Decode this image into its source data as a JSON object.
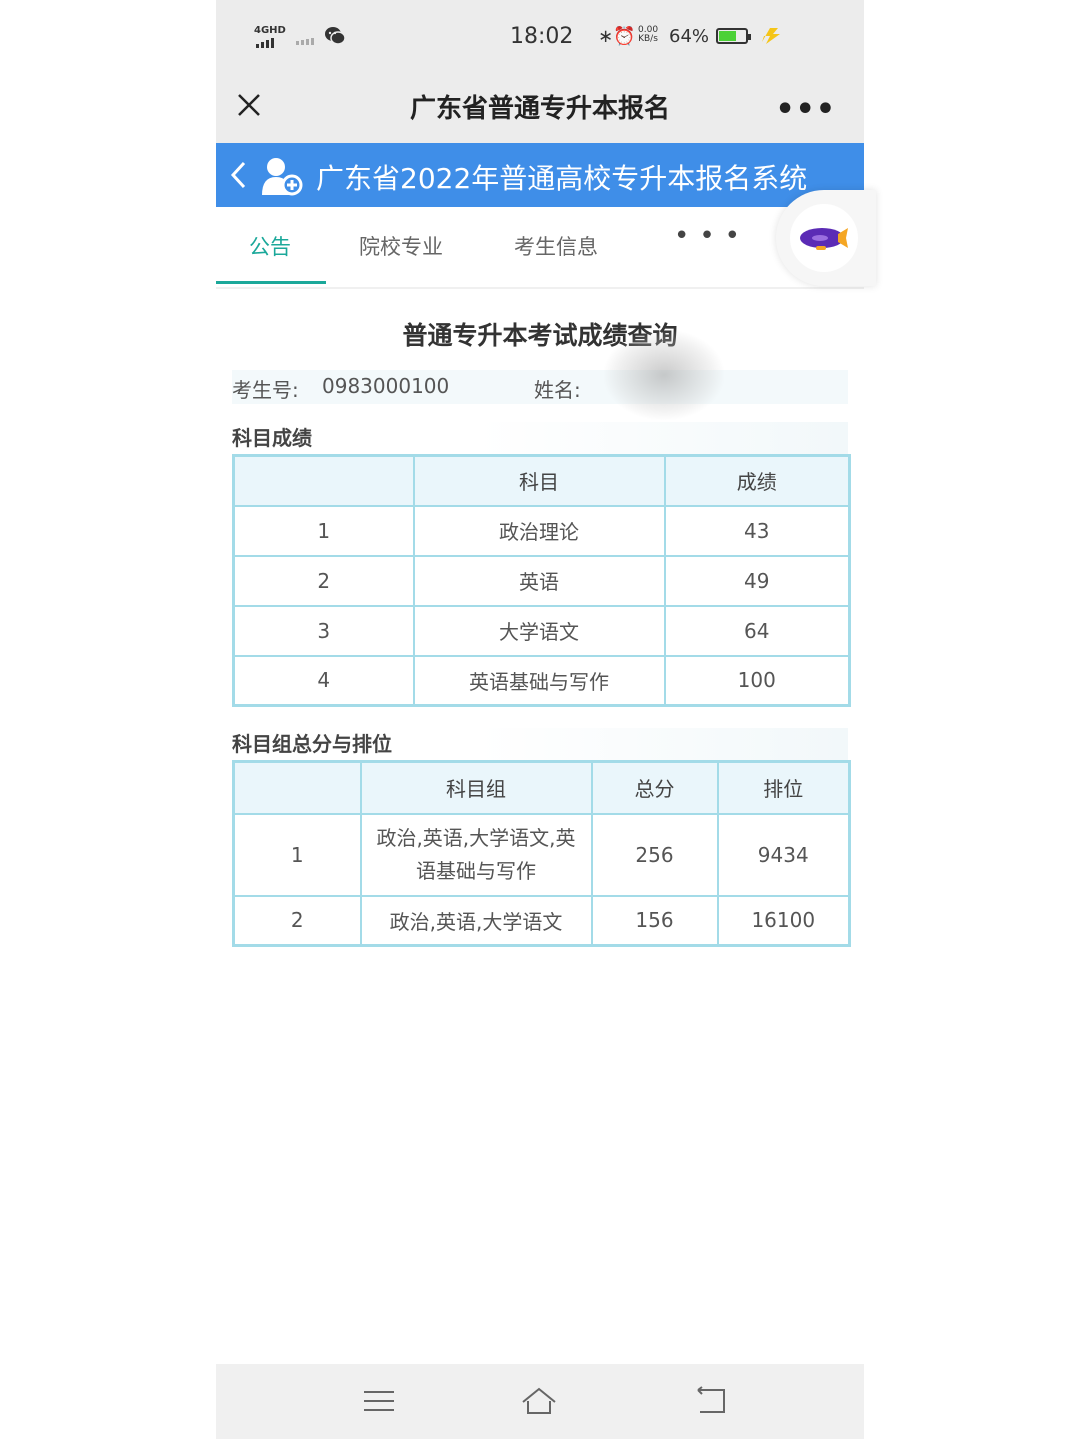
{
  "status_bar": {
    "network": "4GHD",
    "time": "18:02",
    "speed_value": "0.00",
    "speed_unit": "KB/s",
    "battery_percent": "64%",
    "battery_level": 0.64,
    "icons": [
      "signal-icon",
      "wechat-icon",
      "bluetooth-icon",
      "alarm-icon",
      "battery-icon",
      "charging-icon"
    ]
  },
  "wechat_header": {
    "title": "广东省普通专升本报名",
    "more": "•••"
  },
  "app_bar": {
    "title": "广东省2022年普通高校专升本报名系统",
    "color": "#3f8ee8"
  },
  "tabs": [
    {
      "label": "公告",
      "active": true
    },
    {
      "label": "院校专业",
      "active": false
    },
    {
      "label": "考生信息",
      "active": false
    }
  ],
  "tabs_more": "•••",
  "accent_color": "#1ba89a",
  "page": {
    "title": "普通专升本考试成绩查询",
    "candidate_no_label": "考生号:",
    "candidate_no": "0983000100",
    "name_label": "姓名:"
  },
  "scores": {
    "section_label": "科目成绩",
    "headers": [
      "",
      "科目",
      "成绩"
    ],
    "rows": [
      [
        "1",
        "政治理论",
        "43"
      ],
      [
        "2",
        "英语",
        "49"
      ],
      [
        "3",
        "大学语文",
        "64"
      ],
      [
        "4",
        "英语基础与写作",
        "100"
      ]
    ]
  },
  "totals": {
    "section_label": "科目组总分与排位",
    "headers": [
      "",
      "科目组",
      "总分",
      "排位"
    ],
    "rows": [
      [
        "1",
        "政治,英语,大学语文,英语基础与写作",
        "256",
        "9434"
      ],
      [
        "2",
        "政治,英语,大学语文",
        "156",
        "16100"
      ]
    ]
  },
  "nav_bar": {
    "buttons": [
      "menu-icon",
      "home-icon",
      "back-icon"
    ]
  }
}
